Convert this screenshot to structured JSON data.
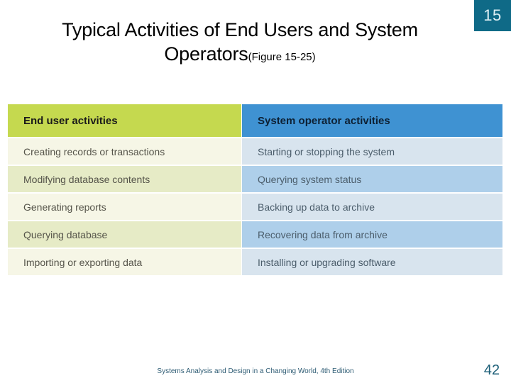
{
  "slide": {
    "badge_number": "15",
    "page_number": "42",
    "footer_credit": "Systems Analysis and Design in a Changing World, 4th Edition",
    "accent_teal": "#0f6a87",
    "accent_green": "#c5d94f",
    "accent_blue": "#3f92d2"
  },
  "title": {
    "line1": "Typical Activities of End Users and System",
    "line2": "Operators",
    "figure_ref": "(Figure 15-25)"
  },
  "table": {
    "headers": [
      "End user activities",
      "System operator activities"
    ],
    "rows": [
      [
        "Creating records or transactions",
        "Starting or stopping the system"
      ],
      [
        "Modifying database contents",
        "Querying system status"
      ],
      [
        "Generating reports",
        "Backing up data to archive"
      ],
      [
        "Querying database",
        "Recovering data from archive"
      ],
      [
        "Importing or exporting data",
        "Installing or upgrading software"
      ]
    ]
  }
}
